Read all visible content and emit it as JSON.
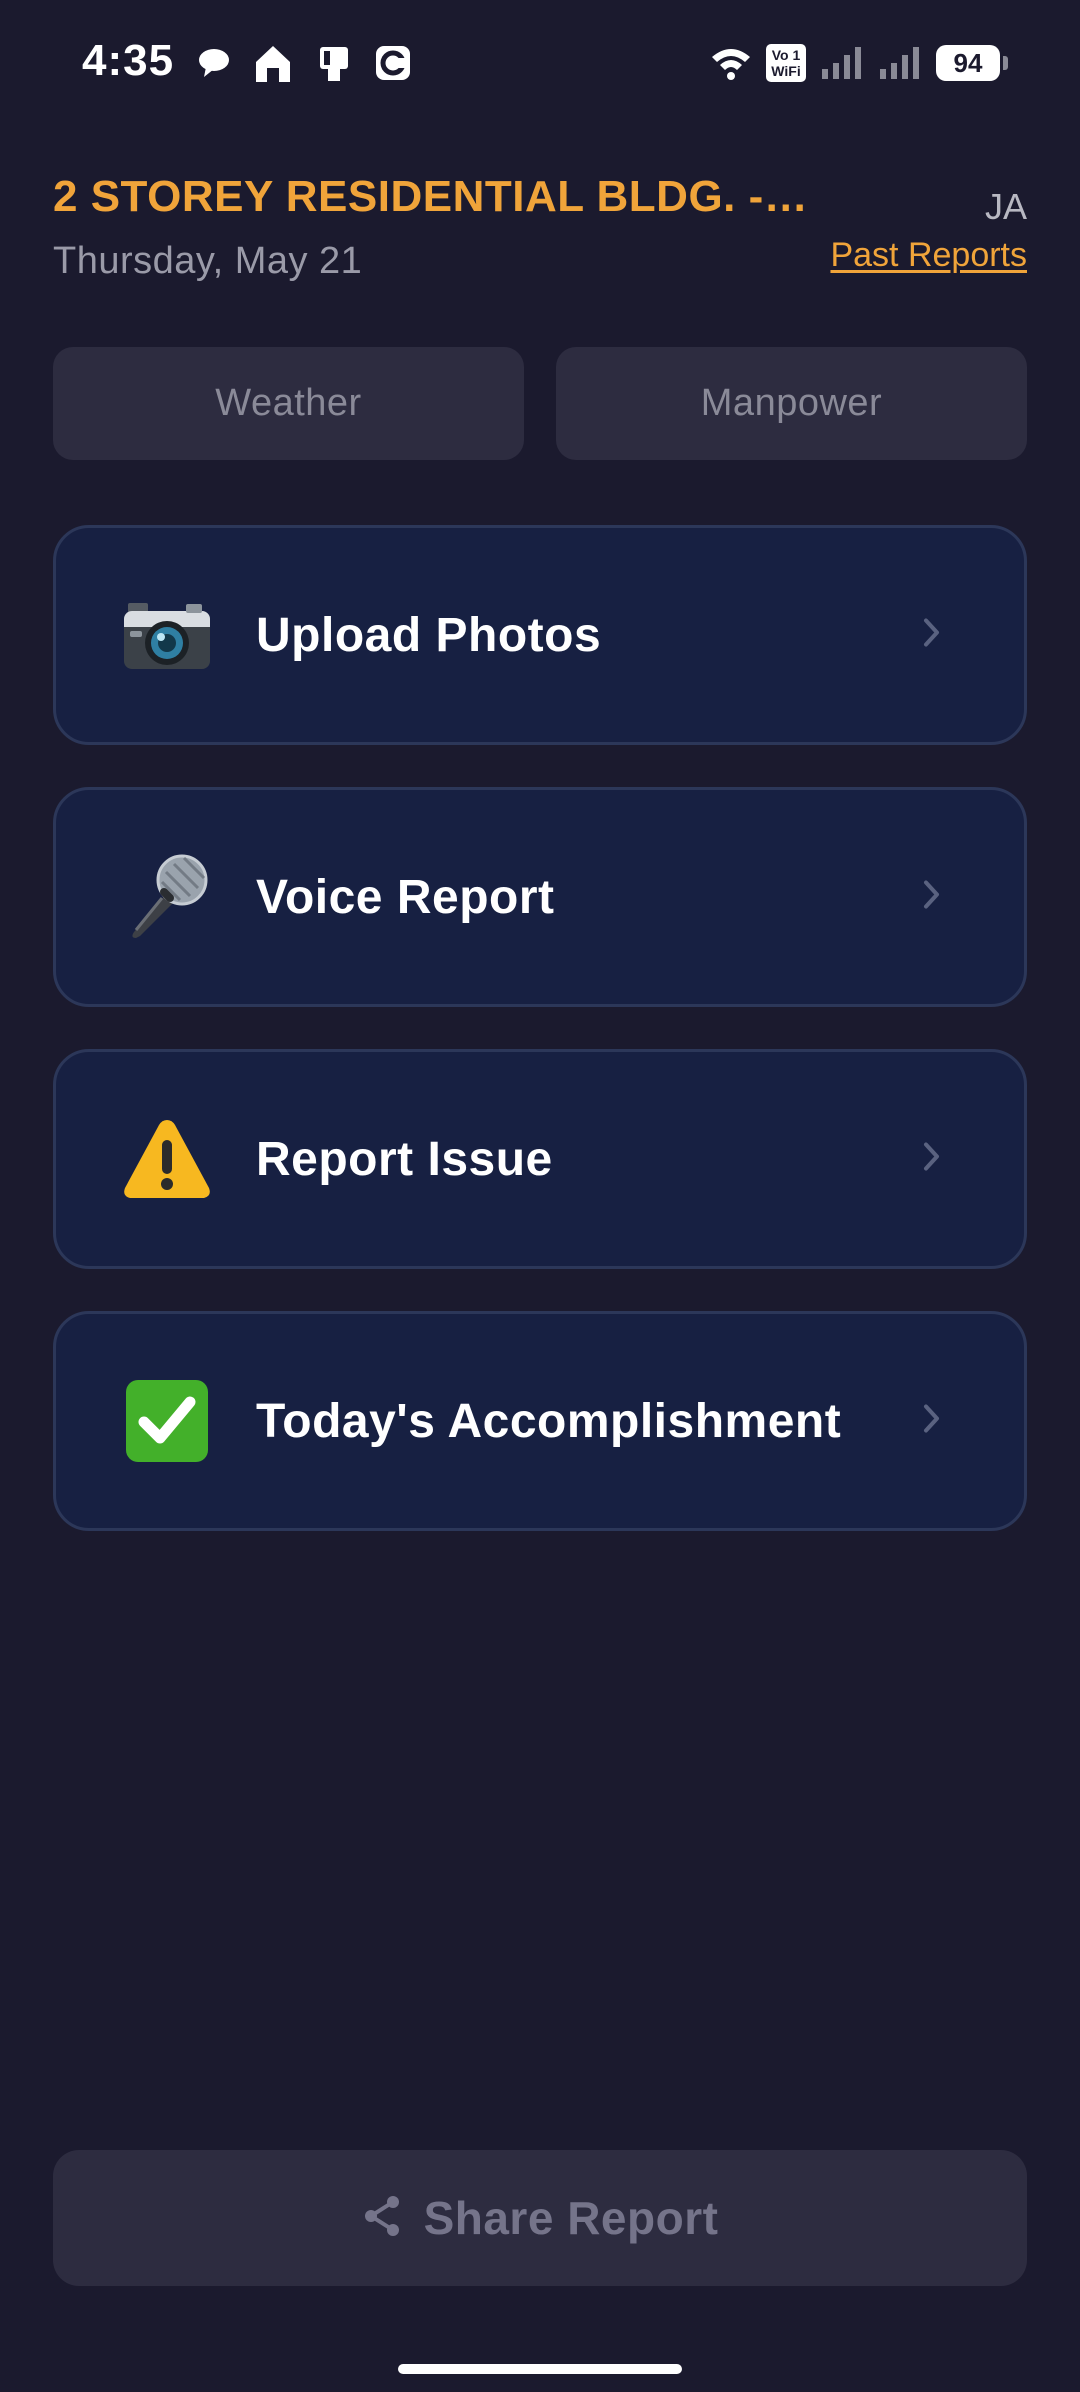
{
  "status_bar": {
    "time": "4:35",
    "left_icons": [
      "chat-bubble-icon",
      "home-icon",
      "sim-card-icon",
      "app-c-icon"
    ],
    "vowifi_top": "Vo 1",
    "vowifi_bottom": "WiFi",
    "battery": "94"
  },
  "header": {
    "project_title": "2 STOREY RESIDENTIAL BLDG. -…",
    "date": "Thursday, May 21",
    "user_initials": "JA",
    "past_reports_label": "Past Reports"
  },
  "toggles": {
    "weather_label": "Weather",
    "manpower_label": "Manpower"
  },
  "actions": [
    {
      "label": "Upload Photos",
      "icon": "camera-icon"
    },
    {
      "label": "Voice Report",
      "icon": "microphone-icon"
    },
    {
      "label": "Report Issue",
      "icon": "warning-icon"
    },
    {
      "label": "Today's Accomplishment",
      "icon": "checkmark-icon"
    }
  ],
  "footer": {
    "share_label": "Share Report",
    "share_icon": "share-icon"
  },
  "colors": {
    "background": "#1b1a2e",
    "accent": "#f0a43a",
    "card_background": "#172042",
    "card_border": "#2c3759",
    "muted_button": "#2d2c40"
  }
}
